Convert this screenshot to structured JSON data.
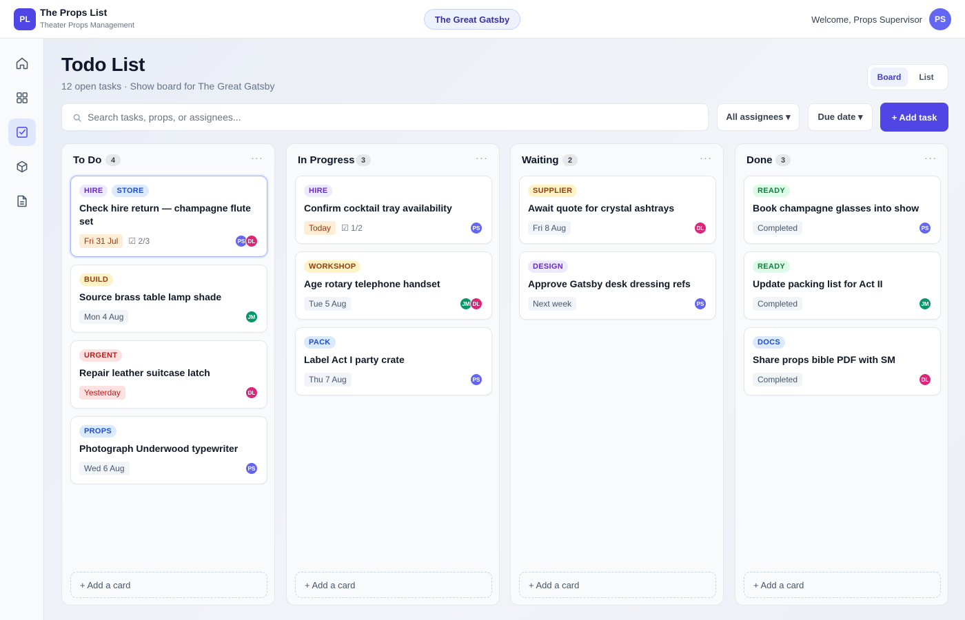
{
  "app": {
    "logo": "PL",
    "title": "The Props List",
    "subtitle": "Theater Props Management"
  },
  "header": {
    "show": "The Great Gatsby",
    "welcome": "Welcome, Props Supervisor",
    "user_initials": "PS"
  },
  "sidebar": {
    "items": [
      {
        "icon": "home-icon",
        "label": "Home"
      },
      {
        "icon": "grid-icon",
        "label": "Dashboard"
      },
      {
        "icon": "checklist-icon",
        "label": "Todo List",
        "active": true
      },
      {
        "icon": "box-icon",
        "label": "Props"
      },
      {
        "icon": "document-icon",
        "label": "Documents"
      }
    ]
  },
  "page": {
    "title": "Todo List",
    "subtitle": "12 open tasks · Show board for The Great Gatsby"
  },
  "view_toggle": {
    "board": "Board",
    "list": "List",
    "selected": "Board"
  },
  "search": {
    "placeholder": "Search tasks, props, or assignees..."
  },
  "filters": {
    "assignees": "All assignees ▾",
    "due": "Due date ▾"
  },
  "add_task": "+ Add task",
  "add_card": "+ Add a card",
  "menu_glyph": "···",
  "checklist_glyph": "☑",
  "tag_colors": {
    "HIRE": {
      "bg": "#ede9fe",
      "fg": "#6d28d9"
    },
    "STORE": {
      "bg": "#dbeafe",
      "fg": "#1d4ed8"
    },
    "BUILD": {
      "bg": "#fef3c7",
      "fg": "#92400e"
    },
    "URGENT": {
      "bg": "#fee2e2",
      "fg": "#b91c1c"
    },
    "PROPS": {
      "bg": "#dbeafe",
      "fg": "#1d4ed8"
    },
    "WORKSHOP": {
      "bg": "#fef3c7",
      "fg": "#92400e"
    },
    "PACK": {
      "bg": "#dbeafe",
      "fg": "#1d4ed8"
    },
    "SUPPLIER": {
      "bg": "#fef3c7",
      "fg": "#92400e"
    },
    "DESIGN": {
      "bg": "#ede9fe",
      "fg": "#6d28d9"
    },
    "READY": {
      "bg": "#dcfce7",
      "fg": "#15803d"
    },
    "DOCS": {
      "bg": "#dbeafe",
      "fg": "#1d4ed8"
    }
  },
  "avatar_colors": {
    "PS": "#6366f1",
    "DL": "#db2777",
    "JM": "#059669"
  },
  "columns": [
    {
      "title": "To Do",
      "count": "4",
      "cards": [
        {
          "tags": [
            "HIRE",
            "STORE"
          ],
          "title": "Check hire return — champagne flute set",
          "due": "Fri 31 Jul",
          "due_style": "today",
          "checklist": "2/3",
          "assignees": [
            "PS",
            "DL"
          ],
          "selected": true
        },
        {
          "tags": [
            "BUILD"
          ],
          "title": "Source brass table lamp shade",
          "due": "Mon 4 Aug",
          "due_style": "normal",
          "checklist": "",
          "assignees": [
            "JM"
          ]
        },
        {
          "tags": [
            "URGENT"
          ],
          "title": "Repair leather suitcase latch",
          "due": "Yesterday",
          "due_style": "overdue",
          "checklist": "",
          "assignees": [
            "DL"
          ]
        },
        {
          "tags": [
            "PROPS"
          ],
          "title": "Photograph Underwood typewriter",
          "due": "Wed 6 Aug",
          "due_style": "normal",
          "checklist": "",
          "assignees": [
            "PS"
          ]
        }
      ]
    },
    {
      "title": "In Progress",
      "count": "3",
      "cards": [
        {
          "tags": [
            "HIRE"
          ],
          "title": "Confirm cocktail tray availability",
          "due": "Today",
          "due_style": "today",
          "checklist": "1/2",
          "assignees": [
            "PS"
          ]
        },
        {
          "tags": [
            "WORKSHOP"
          ],
          "title": "Age rotary telephone handset",
          "due": "Tue 5 Aug",
          "due_style": "normal",
          "checklist": "",
          "assignees": [
            "JM",
            "DL"
          ]
        },
        {
          "tags": [
            "PACK"
          ],
          "title": "Label Act I party crate",
          "due": "Thu 7 Aug",
          "due_style": "normal",
          "checklist": "",
          "assignees": [
            "PS"
          ]
        }
      ]
    },
    {
      "title": "Waiting",
      "count": "2",
      "cards": [
        {
          "tags": [
            "SUPPLIER"
          ],
          "title": "Await quote for crystal ashtrays",
          "due": "Fri 8 Aug",
          "due_style": "normal",
          "checklist": "",
          "assignees": [
            "DL"
          ]
        },
        {
          "tags": [
            "DESIGN"
          ],
          "title": "Approve Gatsby desk dressing refs",
          "due": "Next week",
          "due_style": "normal",
          "checklist": "",
          "assignees": [
            "PS"
          ]
        }
      ]
    },
    {
      "title": "Done",
      "count": "3",
      "cards": [
        {
          "tags": [
            "READY"
          ],
          "title": "Book champagne glasses into show",
          "due": "Completed",
          "due_style": "normal",
          "checklist": "",
          "assignees": [
            "PS"
          ]
        },
        {
          "tags": [
            "READY"
          ],
          "title": "Update packing list for Act II",
          "due": "Completed",
          "due_style": "normal",
          "checklist": "",
          "assignees": [
            "JM"
          ]
        },
        {
          "tags": [
            "DOCS"
          ],
          "title": "Share props bible PDF with SM",
          "due": "Completed",
          "due_style": "normal",
          "checklist": "",
          "assignees": [
            "DL"
          ]
        }
      ]
    }
  ]
}
